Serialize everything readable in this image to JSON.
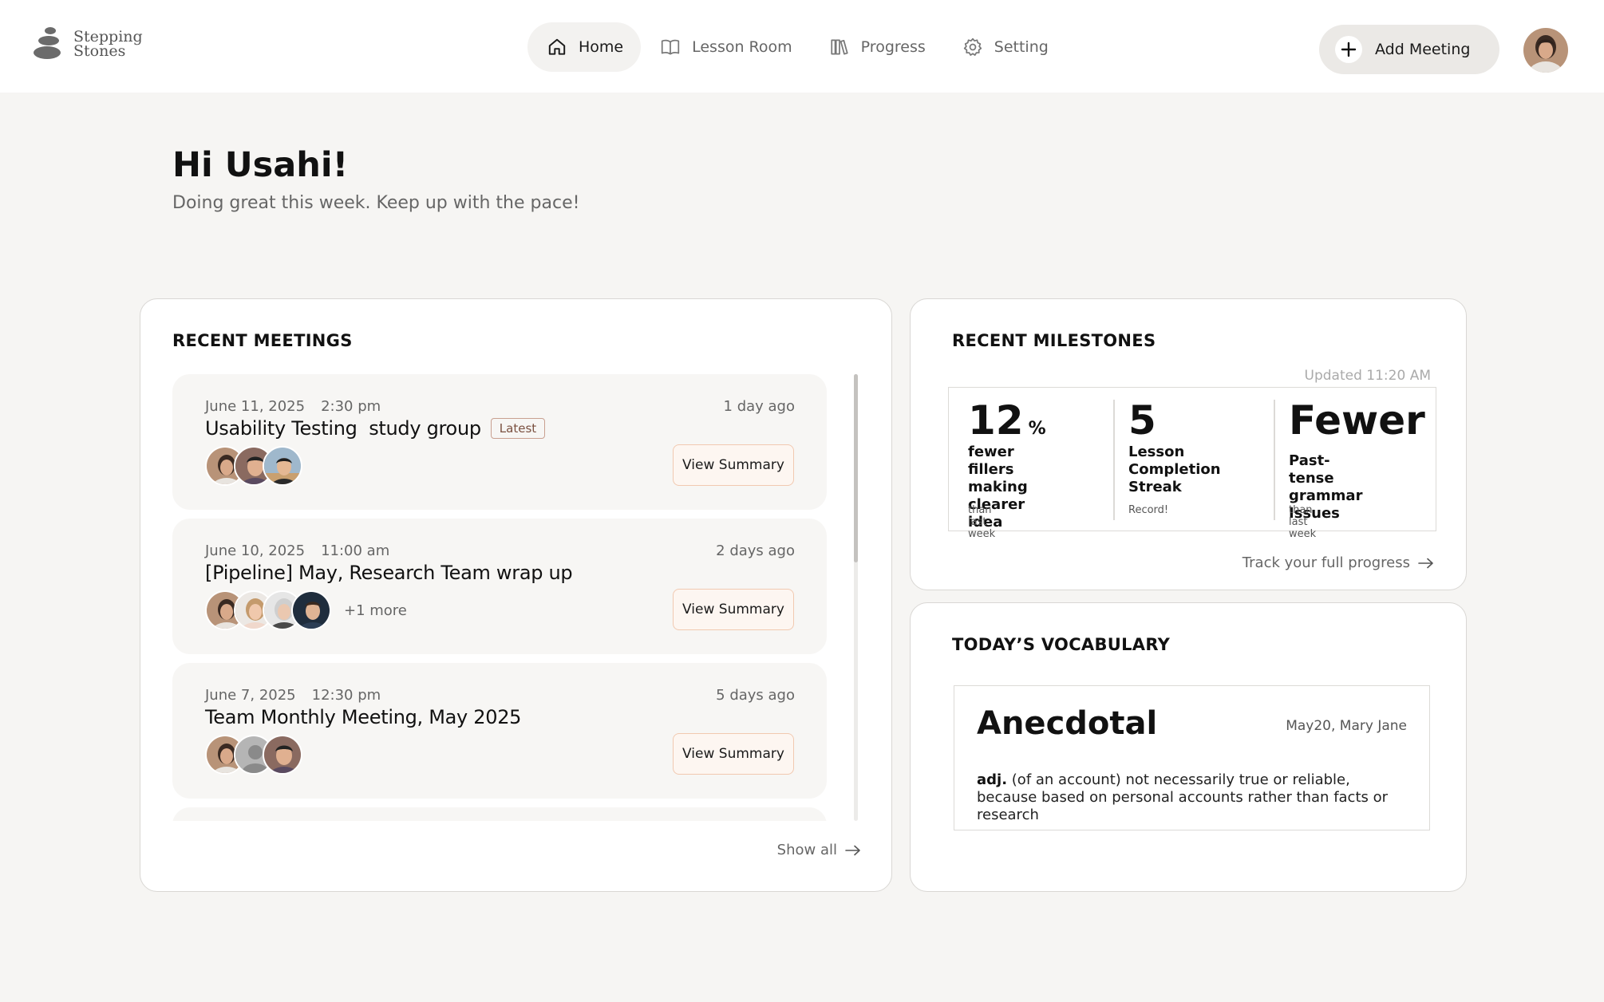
{
  "app": {
    "logo_line1": "Stepping",
    "logo_line2": "Stones"
  },
  "nav": {
    "items": [
      {
        "label": "Home",
        "icon": "home-icon",
        "active": true
      },
      {
        "label": "Lesson Room",
        "icon": "book-icon",
        "active": false
      },
      {
        "label": "Progress",
        "icon": "books-icon",
        "active": false
      },
      {
        "label": "Setting",
        "icon": "gear-icon",
        "active": false
      }
    ],
    "add_meeting_label": "Add Meeting"
  },
  "greeting": {
    "title": "Hi Usahi!",
    "subtitle": "Doing great this week. Keep up with the pace!"
  },
  "meetings": {
    "title": "RECENT MEETINGS",
    "items": [
      {
        "date": "June 11, 2025",
        "time": "2:30 pm",
        "ago": "1 day ago",
        "title": "Usability Testing  study group",
        "badge": "Latest",
        "button": "View Summary",
        "more": ""
      },
      {
        "date": "June 10, 2025",
        "time": "11:00 am",
        "ago": "2 days ago",
        "title": "[Pipeline] May, Research Team wrap up",
        "badge": "",
        "button": "View Summary",
        "more": "+1 more"
      },
      {
        "date": "June 7, 2025",
        "time": "12:30 pm",
        "ago": "5 days ago",
        "title": "Team Monthly Meeting, May 2025",
        "badge": "",
        "button": "View Summary",
        "more": ""
      }
    ],
    "show_all": "Show all"
  },
  "milestones": {
    "title": "RECENT MILESTONES",
    "updated": "Updated 11:20 AM",
    "stats": [
      {
        "big": "12",
        "unit": "%",
        "desc_lines": [
          "fewer fillers",
          "making clearer",
          "idea"
        ],
        "note": "than last week"
      },
      {
        "big": "5",
        "unit": "",
        "desc_lines": [
          "Lesson",
          "Completion",
          "Streak"
        ],
        "note": "Record!"
      },
      {
        "big": "Fewer",
        "unit": "",
        "desc_lines": [
          "Past-tense",
          "grammar Issues"
        ],
        "note": "than last week"
      }
    ],
    "track_link": "Track your full progress"
  },
  "vocabulary": {
    "title": "TODAY’S VOCABULARY",
    "word": "Anecdotal",
    "source": "May20, Mary Jane",
    "pos": "adj.",
    "definition": "(of an account) not necessarily true or reliable, because based on personal accounts rather than facts or research"
  },
  "colors": {
    "background": "#f6f5f3",
    "card": "#ffffff",
    "button_border": "#f1c9b0",
    "button_fill": "#fdf6f1",
    "badge_text": "#7a5040"
  }
}
